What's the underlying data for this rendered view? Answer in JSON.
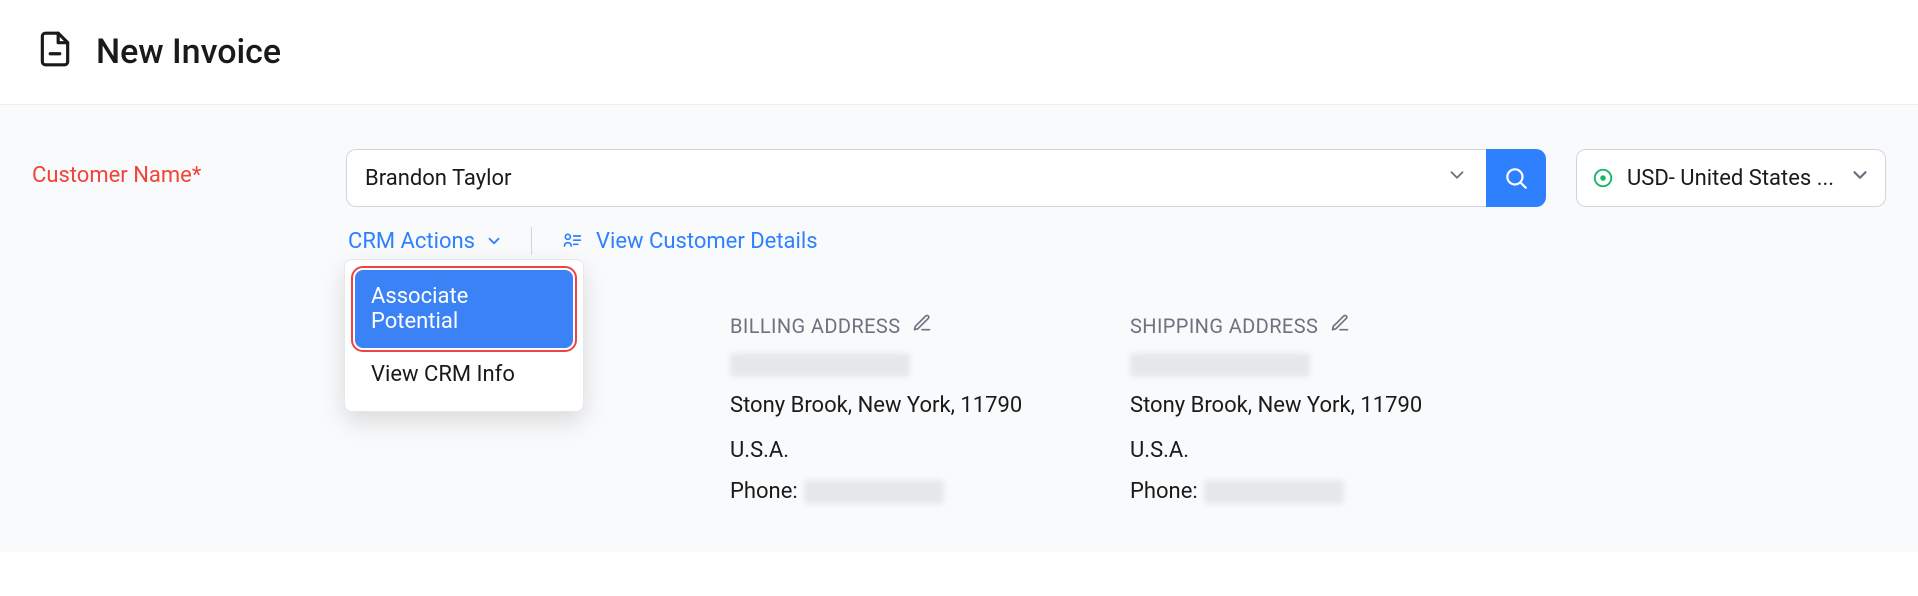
{
  "header": {
    "title": "New Invoice"
  },
  "form": {
    "customer": {
      "label": "Customer Name*",
      "value": "Brandon Taylor"
    },
    "currency": {
      "text": "USD- United States ..."
    },
    "crm_actions_label": "CRM Actions",
    "view_details_label": "View Customer Details",
    "crm_dropdown": [
      "Associate Potential",
      "View CRM Info"
    ],
    "billing": {
      "title": "BILLING ADDRESS",
      "line2": "Stony Brook, New York, 11790",
      "line3": "U.S.A.",
      "phone_label": "Phone:"
    },
    "shipping": {
      "title": "SHIPPING ADDRESS",
      "line2": "Stony Brook, New York, 11790",
      "line3": "U.S.A.",
      "phone_label": "Phone:"
    }
  }
}
